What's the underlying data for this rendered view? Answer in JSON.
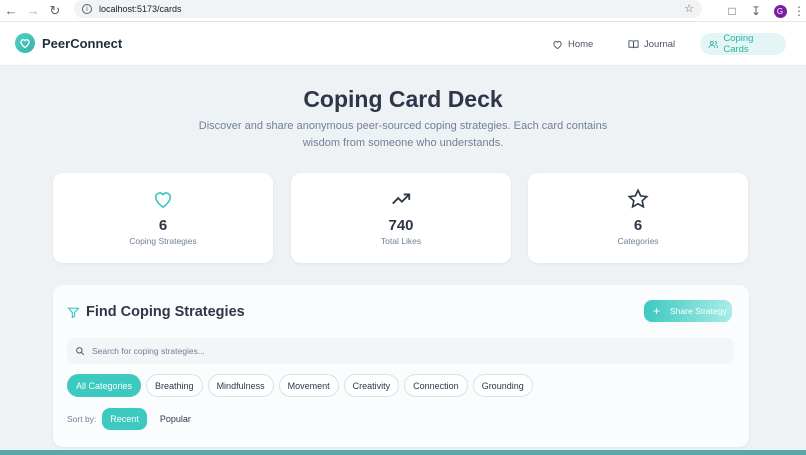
{
  "browser": {
    "url": "localhost:5173/cards",
    "profile_initial": "G"
  },
  "header": {
    "brand": "PeerConnect",
    "nav": [
      {
        "label": "Home",
        "icon": "heart-icon"
      },
      {
        "label": "Journal",
        "icon": "book-icon"
      },
      {
        "label": "Coping Cards",
        "icon": "users-icon",
        "active": true
      }
    ]
  },
  "hero": {
    "title": "Coping Card Deck",
    "subtitle": "Discover and share anonymous peer-sourced coping strategies. Each card contains wisdom from someone who understands."
  },
  "stats": [
    {
      "icon": "heart-icon",
      "value": "6",
      "label": "Coping Strategies"
    },
    {
      "icon": "trending-up-icon",
      "value": "740",
      "label": "Total Likes"
    },
    {
      "icon": "star-icon",
      "value": "6",
      "label": "Categories"
    }
  ],
  "find": {
    "title": "Find Coping Strategies",
    "share_label": "Share Strategy",
    "search_placeholder": "Search for coping strategies...",
    "categories": [
      "All Categories",
      "Breathing",
      "Mindfulness",
      "Movement",
      "Creativity",
      "Connection",
      "Grounding"
    ],
    "selected_category": "All Categories",
    "sort_label": "Sort by:",
    "sort_options": [
      "Recent",
      "Popular"
    ],
    "selected_sort": "Recent"
  },
  "colors": {
    "accent": "#3cc9c0",
    "accent_light": "#e3f6f5",
    "text_dark": "#2d3748",
    "text_muted": "#718096",
    "background": "#eef2f5"
  }
}
